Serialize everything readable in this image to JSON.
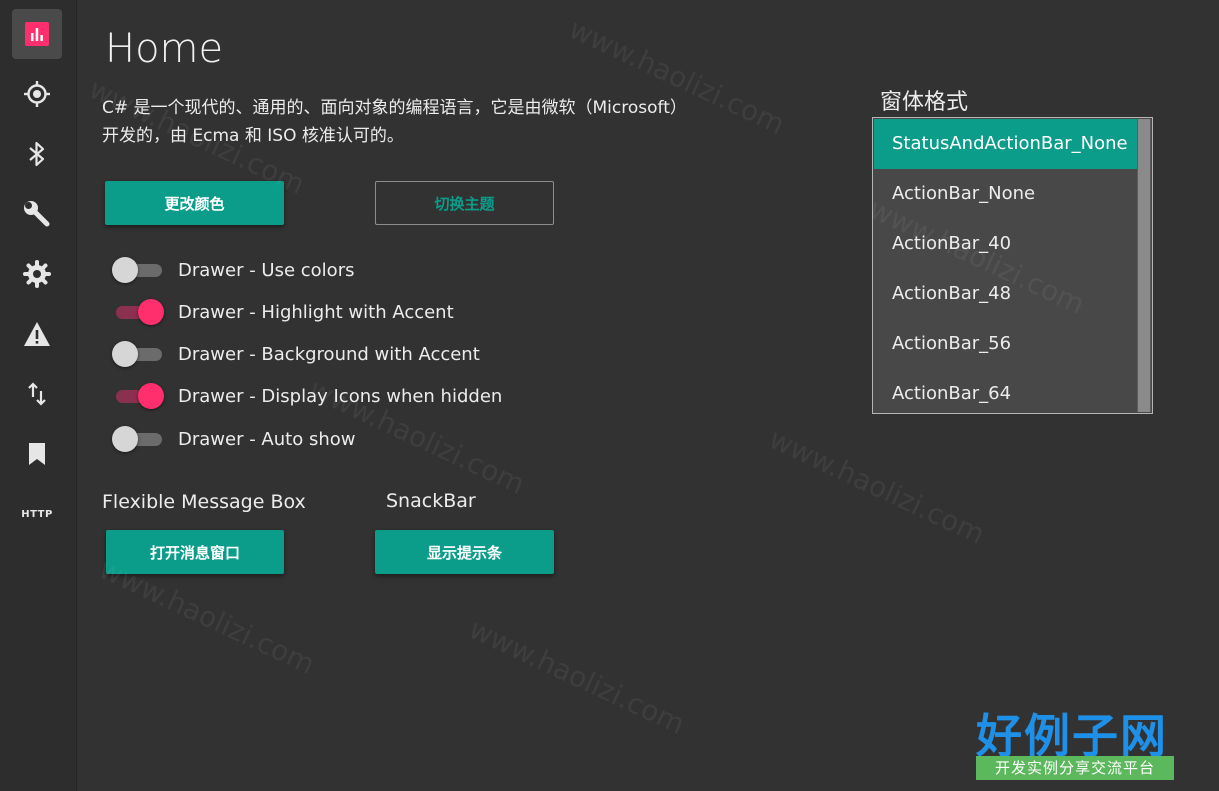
{
  "sidebar": {
    "items": [
      {
        "icon": "chart-icon",
        "active": true
      },
      {
        "icon": "crosshair-icon"
      },
      {
        "icon": "bluetooth-icon"
      },
      {
        "icon": "wrench-icon"
      },
      {
        "icon": "gear-icon"
      },
      {
        "icon": "warning-icon"
      },
      {
        "icon": "swap-vertical-icon"
      },
      {
        "icon": "bookmark-icon"
      },
      {
        "icon": "http-icon",
        "label": "HTTP"
      }
    ]
  },
  "main": {
    "title": "Home",
    "description": "C# 是一个现代的、通用的、面向对象的编程语言，它是由微软（Microsoft）开发的，由 Ecma 和 ISO 核准认可的。",
    "change_color_label": "更改颜色",
    "switch_theme_label": "切换主题",
    "toggles": [
      {
        "label": "Drawer - Use colors",
        "on": false
      },
      {
        "label": "Drawer - Highlight with Accent",
        "on": true
      },
      {
        "label": "Drawer - Background with Accent",
        "on": false
      },
      {
        "label": "Drawer - Display Icons when hidden",
        "on": true
      },
      {
        "label": "Drawer - Auto show",
        "on": false
      }
    ],
    "message_box_label": "Flexible Message Box",
    "snackbar_label": "SnackBar",
    "open_message_label": "打开消息窗口",
    "show_snackbar_label": "显示提示条"
  },
  "window_format": {
    "title": "窗体格式",
    "options": [
      "StatusAndActionBar_None",
      "ActionBar_None",
      "ActionBar_40",
      "ActionBar_48",
      "ActionBar_56",
      "ActionBar_64"
    ],
    "selected_index": 0
  },
  "watermark": {
    "text": "www.haolizi.com",
    "logo": "好例子网",
    "logo_sub": "开发实例分享交流平台"
  },
  "colors": {
    "accent": "#0b9c8a",
    "toggle_on": "#ff2f6e",
    "background": "#323232",
    "logo_blue": "#1e90e8",
    "logo_green": "#5cb85c"
  }
}
